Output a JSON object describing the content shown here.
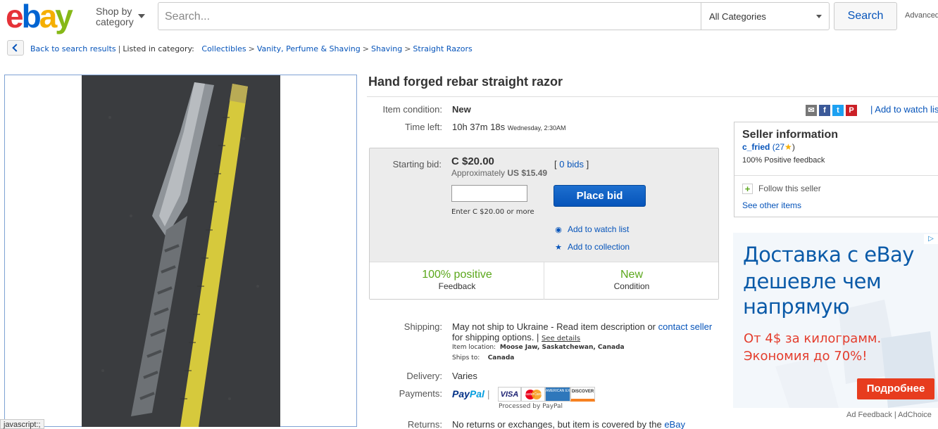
{
  "header": {
    "logo": {
      "e": "e",
      "b": "b",
      "a": "a",
      "y": "y"
    },
    "shop_by_line1": "Shop by",
    "shop_by_line2": "category",
    "search_placeholder": "Search...",
    "category_value": "All Categories",
    "search_button": "Search",
    "advanced": "Advanced"
  },
  "breadcrumb": {
    "back": "Back to search results",
    "listed_in": "Listed in category:",
    "items": [
      "Collectibles",
      "Vanity, Perfume & Shaving",
      "Shaving",
      "Straight Razors"
    ]
  },
  "listing": {
    "title": "Hand forged rebar straight razor",
    "condition_label": "Item condition:",
    "condition_value": "New",
    "time_left_label": "Time left:",
    "time_left_value": "10h 37m 18s",
    "time_left_date": "Wednesday, 2:30AM",
    "share": {
      "email_icon": "envelope-icon",
      "facebook_icon": "f",
      "twitter_icon": "t",
      "pinterest_icon": "P"
    },
    "add_to_watch": "| Add to watch list"
  },
  "bid": {
    "starting_label": "Starting bid:",
    "price": "C $20.00",
    "approx": "Approximately ",
    "approx_value": "US $15.49",
    "bids_open": "[",
    "bids_link": "0 bids",
    "bids_close": "]",
    "hint": "Enter C $20.00 or more",
    "place_bid": "Place bid",
    "watch": "Add to watch list",
    "collection": "Add to collection",
    "feedback_value": "100% positive",
    "feedback_label": "Feedback",
    "condition_value": "New",
    "condition_label": "Condition"
  },
  "shipping": {
    "label": "Shipping:",
    "line1": "May not ship to Ukraine - Read item description or ",
    "contact": "contact seller",
    "line2": "for shipping options. | ",
    "see_details": "See details",
    "location_label": "Item location:",
    "location": "Moose Jaw, Saskatchewan, Canada",
    "ships_label": "Ships to:",
    "ships_to": "Canada"
  },
  "delivery": {
    "label": "Delivery:",
    "value": "Varies"
  },
  "payments": {
    "label": "Payments:",
    "paypal_pay": "Pay",
    "paypal_pal": "Pal",
    "cards": [
      "VISA",
      "MasterCard",
      "AMERICAN EXPRESS",
      "DISCOVER"
    ],
    "processed": "Processed by PayPal"
  },
  "returns": {
    "label": "Returns:",
    "value": "No returns or exchanges, but item is covered by the ",
    "link": "eBay"
  },
  "seller": {
    "heading": "Seller information",
    "name": "c_fried",
    "score": "(27",
    "score_close": ")",
    "positive": "100% Positive feedback",
    "follow": "Follow this seller",
    "see_other": "See other items"
  },
  "ad": {
    "line1": "Доставка с eBay",
    "line2": "дешевле чем",
    "line3": "напрямую",
    "sub1": "От 4$ за килограмм.",
    "sub2": "Экономия до 70%!",
    "button": "Подробнее",
    "badge": "▷",
    "footer": "Ad Feedback  |  AdChoice"
  },
  "status_bar": "javascript:;",
  "colors": {
    "link": "#0654ba",
    "positive": "#5ba71b",
    "button": "#0654ba",
    "ad_red": "#e43d2d",
    "ad_blue": "#0a5aa8"
  }
}
